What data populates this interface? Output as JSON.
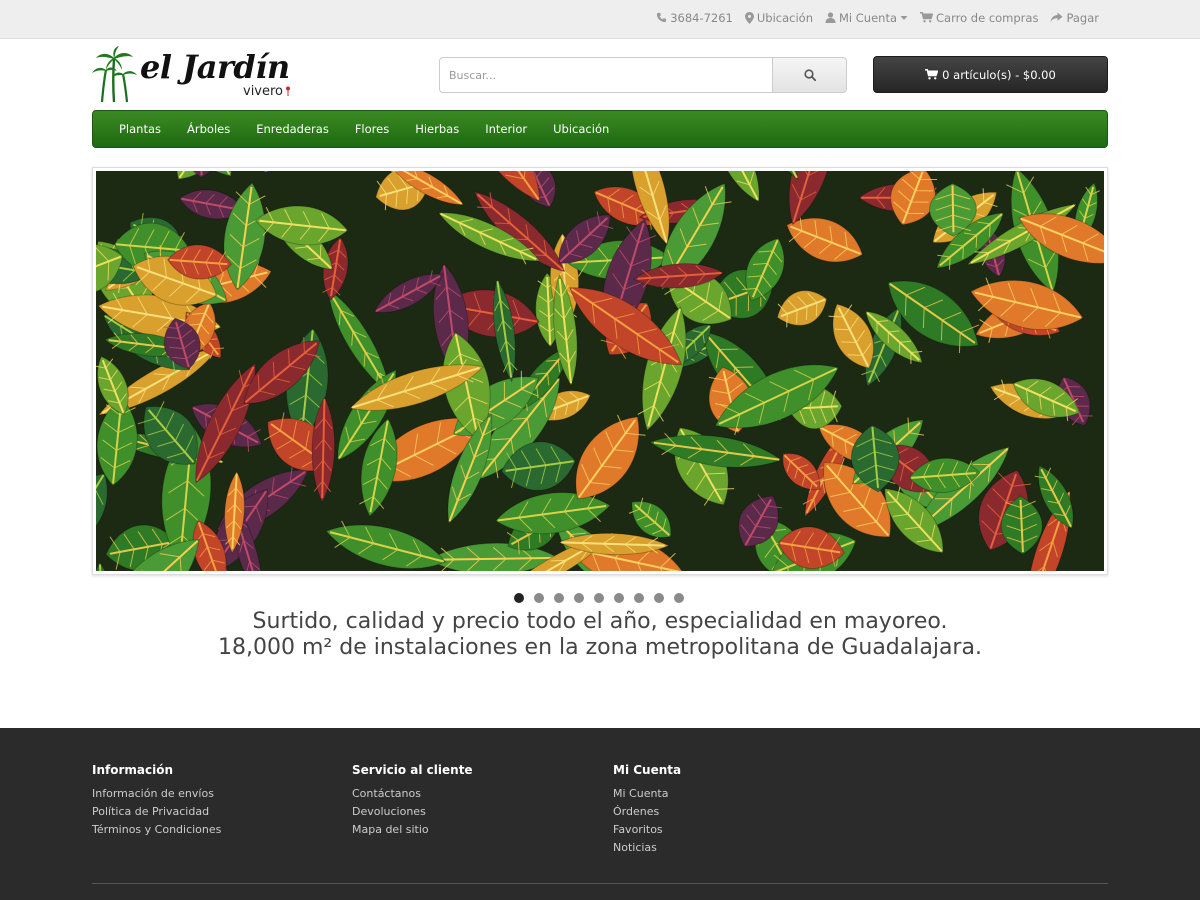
{
  "topbar": {
    "phone": "3684-7261",
    "location": "Ubicación",
    "account": "Mi Cuenta",
    "cart": "Carro de compras",
    "checkout": "Pagar"
  },
  "logo": {
    "name": "el Jardín",
    "subtitle": "vivero"
  },
  "search": {
    "placeholder": "Buscar..."
  },
  "cart_button": {
    "label": "0 artículo(s) - $0.00"
  },
  "nav": {
    "items": [
      "Plantas",
      "Árboles",
      "Enredaderas",
      "Flores",
      "Hierbas",
      "Interior",
      "Ubicación"
    ]
  },
  "slideshow": {
    "slide_count": 9,
    "active_index": 0
  },
  "tagline": {
    "line1": "Surtido, calidad y precio todo el año, especialidad en mayoreo.",
    "line2": "18,000 m² de instalaciones en la zona metropolitana de Guadalajara."
  },
  "footer": {
    "info": {
      "title": "Información",
      "links": [
        "Información de envíos",
        "Política de Privacidad",
        "Términos y Condiciones"
      ]
    },
    "service": {
      "title": "Servicio al cliente",
      "links": [
        "Contáctanos",
        "Devoluciones",
        "Mapa del sitio"
      ]
    },
    "account": {
      "title": "Mi Cuenta",
      "links": [
        "Mi Cuenta",
        "Órdenes",
        "Favoritos",
        "Noticias"
      ]
    }
  },
  "colors": {
    "nav_green": "#2a7a19",
    "topbar_bg": "#eeeeee",
    "footer_bg": "#2b2b2b",
    "cart_bg": "#333333"
  }
}
